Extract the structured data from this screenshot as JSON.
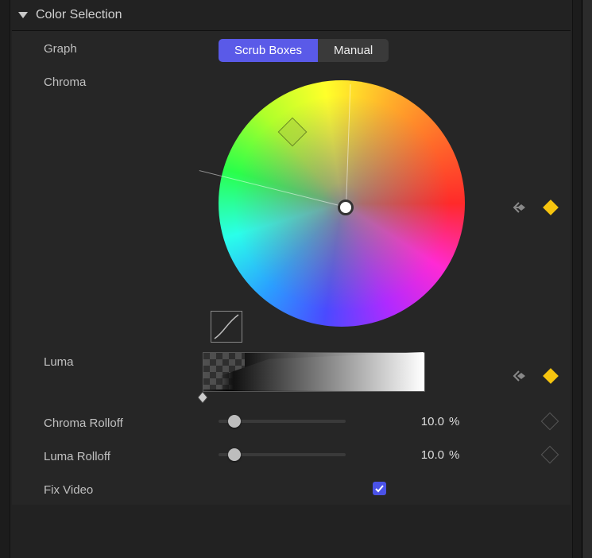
{
  "section_title": "Color Selection",
  "graph": {
    "label": "Graph",
    "mode_scrub": "Scrub Boxes",
    "mode_manual": "Manual",
    "active": "scrub"
  },
  "chroma": {
    "label": "Chroma",
    "keyframe_active": true
  },
  "luma": {
    "label": "Luma",
    "keyframe_active": true
  },
  "chroma_rolloff": {
    "label": "Chroma Rolloff",
    "value": "10.0",
    "unit": "%",
    "slider_pct": 10
  },
  "luma_rolloff": {
    "label": "Luma Rolloff",
    "value": "10.0",
    "unit": "%",
    "slider_pct": 10
  },
  "fix_video": {
    "label": "Fix Video",
    "checked": true
  }
}
